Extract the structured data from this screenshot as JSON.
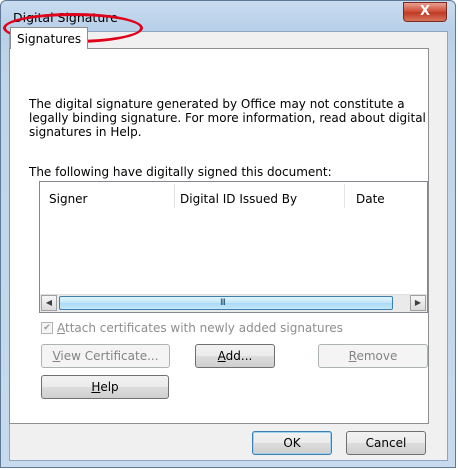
{
  "window": {
    "title": "Digital Signature",
    "close_symbol": "X"
  },
  "tab": {
    "label": "Signatures"
  },
  "description": "The digital signature generated by Office may not constitute a legally binding signature. For more information, read about digital signatures in Help.",
  "list": {
    "caption": "The following have digitally signed this document:",
    "columns": [
      "Signer",
      "Digital ID Issued By",
      "Date"
    ],
    "rows": [],
    "scroll_left": "◀",
    "scroll_right": "▶",
    "scroll_grip": "III"
  },
  "attach_checkbox": {
    "label_pre": "",
    "label_mnemonic": "A",
    "label_post": "ttach certificates with newly added signatures",
    "checked": true,
    "enabled": false
  },
  "buttons": {
    "view_certificate": {
      "pre": "",
      "mnemonic": "V",
      "post": "iew Certificate...",
      "enabled": false
    },
    "add": {
      "pre": "",
      "mnemonic": "A",
      "post": "dd...",
      "enabled": true
    },
    "remove": {
      "pre": "",
      "mnemonic": "R",
      "post": "emove",
      "enabled": false
    },
    "help": {
      "pre": "",
      "mnemonic": "H",
      "post": "elp",
      "enabled": true
    },
    "ok": {
      "label": "OK"
    },
    "cancel": {
      "label": "Cancel"
    }
  },
  "colors": {
    "title_highlight": "#e0001a",
    "close_button": "#c03a24",
    "scroll_thumb": "#a8d9f5"
  }
}
